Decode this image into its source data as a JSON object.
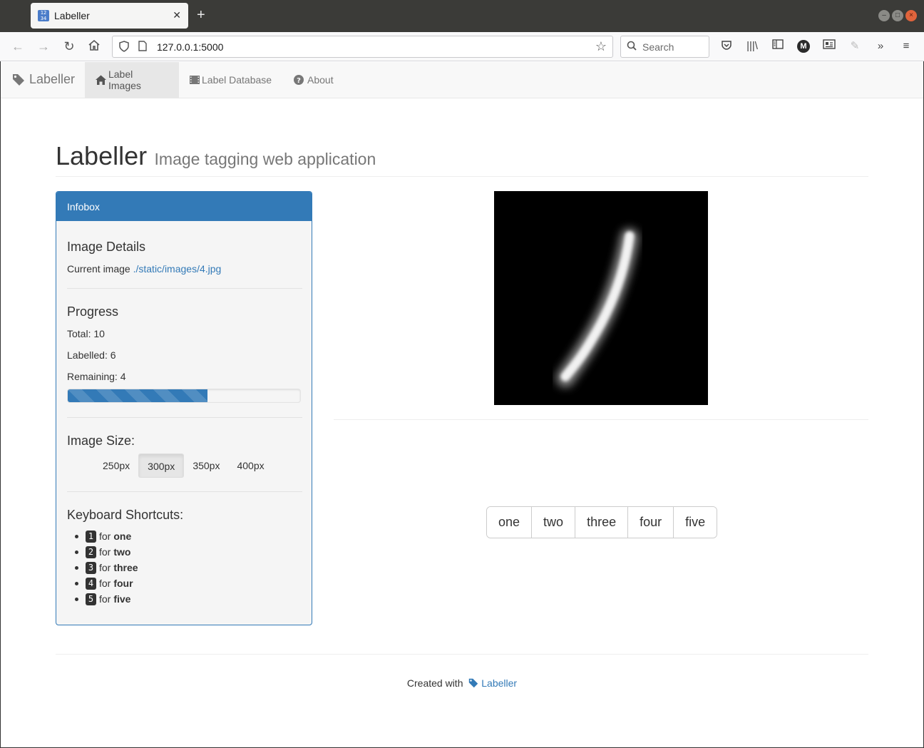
{
  "browser": {
    "tab_title": "Labeller",
    "tab_close": "✕",
    "new_tab": "+",
    "url": "127.0.0.1:5000",
    "search_placeholder": "Search",
    "account_initial": "M"
  },
  "appnav": {
    "brand": "Labeller",
    "items": [
      {
        "label": "Label Images",
        "icon": "home-icon",
        "active": true
      },
      {
        "label": "Label Database",
        "icon": "film-icon",
        "active": false
      },
      {
        "label": "About",
        "icon": "question-circle-icon",
        "active": false
      }
    ]
  },
  "header": {
    "title": "Labeller",
    "subtitle": "Image tagging web application"
  },
  "infobox": {
    "heading": "Infobox",
    "image_details": {
      "title": "Image Details",
      "current_label": "Current image",
      "current_path": "./static/images/4.jpg"
    },
    "progress": {
      "title": "Progress",
      "total": "Total: 10",
      "labelled": "Labelled: 6",
      "remaining": "Remaining: 4",
      "fraction": 0.6
    },
    "image_size": {
      "title": "Image Size:",
      "options": [
        "250px",
        "300px",
        "350px",
        "400px"
      ],
      "selected": "300px"
    },
    "shortcuts": {
      "title": "Keyboard Shortcuts:",
      "for_word": "for",
      "items": [
        {
          "key": "1",
          "label": "one"
        },
        {
          "key": "2",
          "label": "two"
        },
        {
          "key": "3",
          "label": "three"
        },
        {
          "key": "4",
          "label": "four"
        },
        {
          "key": "5",
          "label": "five"
        }
      ]
    }
  },
  "labels": [
    "one",
    "two",
    "three",
    "four",
    "five"
  ],
  "footer": {
    "text": "Created with",
    "link": "Labeller"
  },
  "colors": {
    "primary": "#337ab7",
    "navbar_bg": "#f8f8f8"
  }
}
